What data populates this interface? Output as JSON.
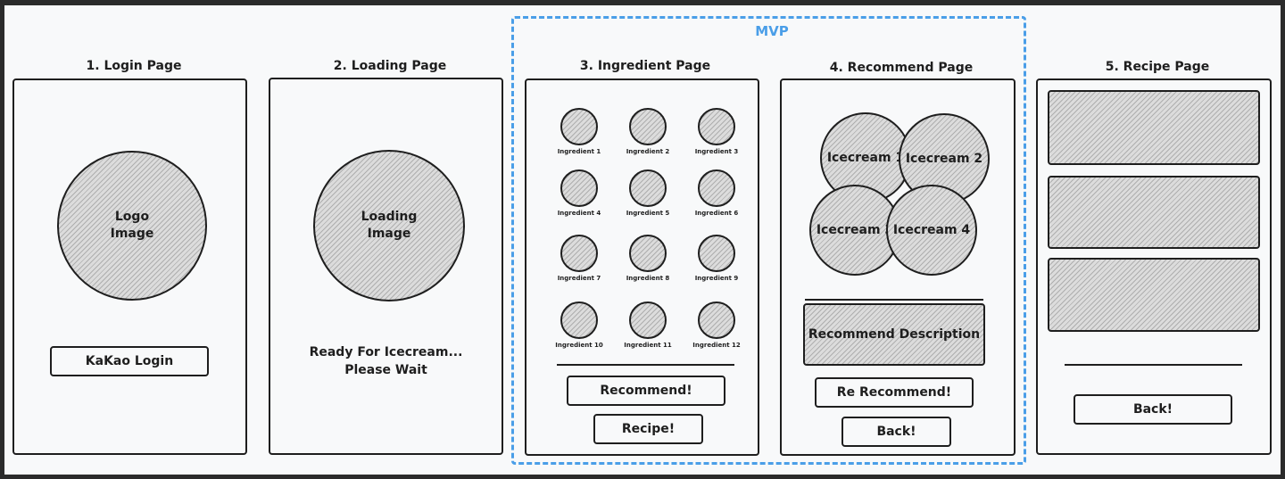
{
  "mvp": {
    "label": "MVP",
    "color": "#4a9ee8"
  },
  "login": {
    "title": "1. Login Page",
    "logo_label": "Logo\nImage",
    "button_label": "KaKao Login"
  },
  "loading": {
    "title": "2. Loading Page",
    "image_label": "Loading\nImage",
    "message": "Ready For Icecream...\nPlease Wait"
  },
  "ingredient": {
    "title": "3. Ingredient Page",
    "items": [
      {
        "label": "Ingredient 1"
      },
      {
        "label": "Ingredient 2"
      },
      {
        "label": "Ingredient 3"
      },
      {
        "label": "Ingredient 4"
      },
      {
        "label": "Ingredient 5"
      },
      {
        "label": "Ingredient 6"
      },
      {
        "label": "Ingredient 7"
      },
      {
        "label": "Ingredient 8"
      },
      {
        "label": "Ingredient 9"
      },
      {
        "label": "Ingredient 10"
      },
      {
        "label": "Ingredient 11"
      },
      {
        "label": "Ingredient 12"
      }
    ],
    "recommend_button": "Recommend!",
    "recipe_button": "Recipe!"
  },
  "recommend": {
    "title": "4. Recommend Page",
    "icecreams": [
      {
        "label": "Icecream 1"
      },
      {
        "label": "Icecream 2"
      },
      {
        "label": "Icecream 3"
      },
      {
        "label": "Icecream 4"
      }
    ],
    "description": "Recommend Description",
    "rerecommend_button": "Re Recommend!",
    "back_button": "Back!"
  },
  "recipe": {
    "title": "5. Recipe Page",
    "back_button": "Back!"
  }
}
